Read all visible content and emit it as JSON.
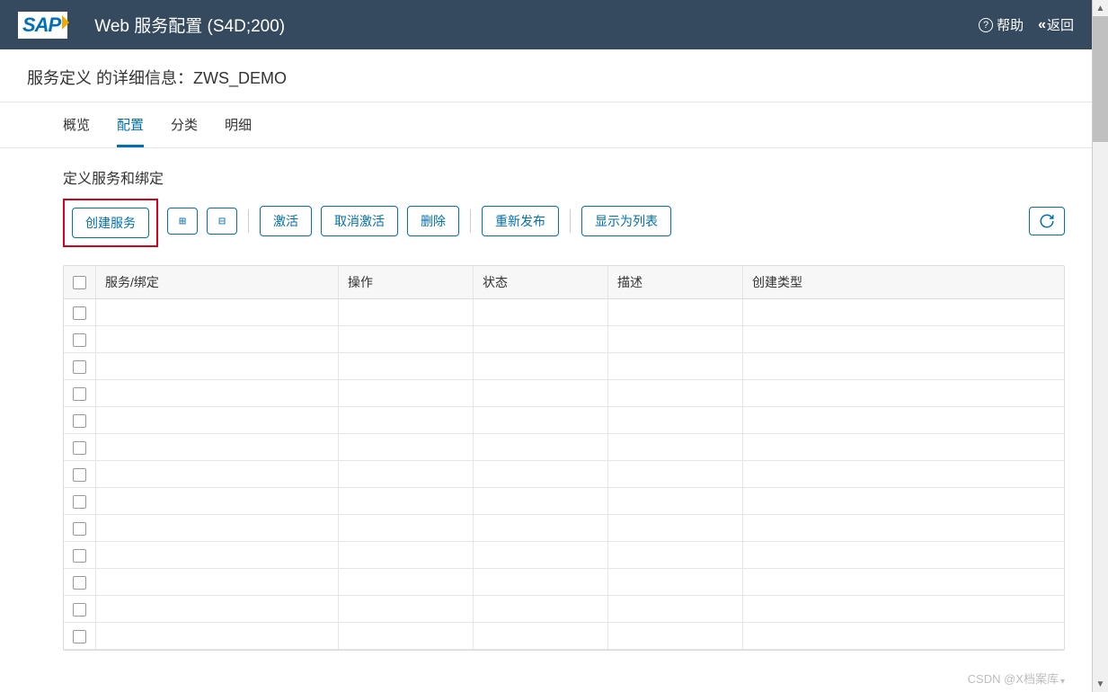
{
  "header": {
    "logo_text": "SAP",
    "title": "Web 服务配置 (S4D;200)",
    "help_label": "帮助",
    "back_label": "返回"
  },
  "subheader": {
    "text": "服务定义 的详细信息：ZWS_DEMO"
  },
  "tabs": [
    {
      "label": "概览",
      "active": false
    },
    {
      "label": "配置",
      "active": true
    },
    {
      "label": "分类",
      "active": false
    },
    {
      "label": "明细",
      "active": false
    }
  ],
  "section": {
    "title": "定义服务和绑定"
  },
  "toolbar": {
    "create_label": "创建服务",
    "expand_icon": "expand-all-icon",
    "collapse_icon": "collapse-all-icon",
    "activate_label": "激活",
    "deactivate_label": "取消激活",
    "delete_label": "删除",
    "republish_label": "重新发布",
    "show_as_list_label": "显示为列表",
    "refresh_icon": "refresh-icon"
  },
  "table": {
    "columns": {
      "binding": "服务/绑定",
      "action": "操作",
      "status": "状态",
      "desc": "描述",
      "create_type": "创建类型"
    },
    "row_count": 13
  },
  "watermark": "CSDN @X档案库"
}
